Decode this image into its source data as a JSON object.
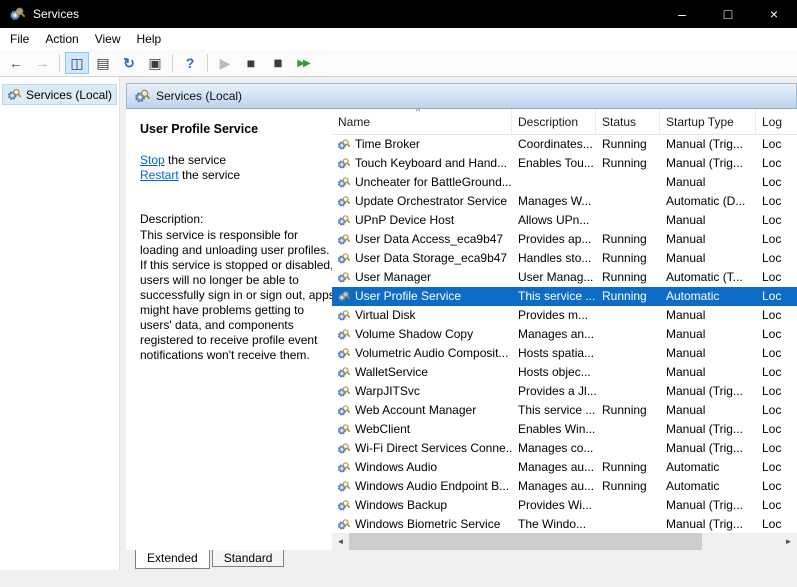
{
  "titlebar": {
    "title": "Services",
    "minimize_glyph": "–",
    "maximize_glyph": "□",
    "close_glyph": "×"
  },
  "menu": {
    "items": [
      "File",
      "Action",
      "View",
      "Help"
    ]
  },
  "toolbar": {
    "buttons": [
      {
        "name": "back-arrow-icon",
        "glyph": "←"
      },
      {
        "name": "forward-arrow-icon",
        "glyph": "→"
      },
      {
        "name": "show-hide-console-tree-icon",
        "glyph": "◫"
      },
      {
        "name": "export-list-icon",
        "glyph": "▤"
      },
      {
        "name": "refresh-icon",
        "glyph": "↻"
      },
      {
        "name": "properties-icon",
        "glyph": "▣"
      },
      {
        "name": "help-icon",
        "glyph": "?"
      },
      {
        "name": "start-service-icon",
        "glyph": "▶"
      },
      {
        "name": "stop-service-icon",
        "glyph": "■"
      },
      {
        "name": "pause-service-icon",
        "glyph": "▮▮"
      },
      {
        "name": "restart-service-icon",
        "glyph": "▶▶"
      }
    ]
  },
  "tree": {
    "root_label": "Services (Local)"
  },
  "content_header": {
    "label": "Services (Local)"
  },
  "extended_panel": {
    "service_title": "User Profile Service",
    "stop_link": "Stop",
    "stop_suffix": " the service",
    "restart_link": "Restart",
    "restart_suffix": " the service",
    "description_label": "Description:",
    "description_text": "This service is responsible for loading and unloading user profiles. If this service is stopped or disabled, users will no longer be able to successfully sign in or sign out, apps might have problems getting to users' data, and components registered to receive profile event notifications won't receive them."
  },
  "table": {
    "columns": [
      "Name",
      "Description",
      "Status",
      "Startup Type",
      "Log"
    ],
    "sort_indicator": "^",
    "selected_index": 8,
    "rows": [
      {
        "name": "Time Broker",
        "description": "Coordinates...",
        "status": "Running",
        "startup": "Manual (Trig...",
        "logon": "Loc"
      },
      {
        "name": "Touch Keyboard and Hand...",
        "description": "Enables Tou...",
        "status": "Running",
        "startup": "Manual (Trig...",
        "logon": "Loc"
      },
      {
        "name": "Uncheater for BattleGround...",
        "description": "",
        "status": "",
        "startup": "Manual",
        "logon": "Loc"
      },
      {
        "name": "Update Orchestrator Service",
        "description": "Manages W...",
        "status": "",
        "startup": "Automatic (D...",
        "logon": "Loc"
      },
      {
        "name": "UPnP Device Host",
        "description": "Allows UPn...",
        "status": "",
        "startup": "Manual",
        "logon": "Loc"
      },
      {
        "name": "User Data Access_eca9b47",
        "description": "Provides ap...",
        "status": "Running",
        "startup": "Manual",
        "logon": "Loc"
      },
      {
        "name": "User Data Storage_eca9b47",
        "description": "Handles sto...",
        "status": "Running",
        "startup": "Manual",
        "logon": "Loc"
      },
      {
        "name": "User Manager",
        "description": "User Manag...",
        "status": "Running",
        "startup": "Automatic (T...",
        "logon": "Loc"
      },
      {
        "name": "User Profile Service",
        "description": "This service ...",
        "status": "Running",
        "startup": "Automatic",
        "logon": "Loc"
      },
      {
        "name": "Virtual Disk",
        "description": "Provides m...",
        "status": "",
        "startup": "Manual",
        "logon": "Loc"
      },
      {
        "name": "Volume Shadow Copy",
        "description": "Manages an...",
        "status": "",
        "startup": "Manual",
        "logon": "Loc"
      },
      {
        "name": "Volumetric Audio Composit...",
        "description": "Hosts spatia...",
        "status": "",
        "startup": "Manual",
        "logon": "Loc"
      },
      {
        "name": "WalletService",
        "description": "Hosts objec...",
        "status": "",
        "startup": "Manual",
        "logon": "Loc"
      },
      {
        "name": "WarpJITSvc",
        "description": "Provides a Jl...",
        "status": "",
        "startup": "Manual (Trig...",
        "logon": "Loc"
      },
      {
        "name": "Web Account Manager",
        "description": "This service ...",
        "status": "Running",
        "startup": "Manual",
        "logon": "Loc"
      },
      {
        "name": "WebClient",
        "description": "Enables Win...",
        "status": "",
        "startup": "Manual (Trig...",
        "logon": "Loc"
      },
      {
        "name": "Wi-Fi Direct Services Conne...",
        "description": "Manages co...",
        "status": "",
        "startup": "Manual (Trig...",
        "logon": "Loc"
      },
      {
        "name": "Windows Audio",
        "description": "Manages au...",
        "status": "Running",
        "startup": "Automatic",
        "logon": "Loc"
      },
      {
        "name": "Windows Audio Endpoint B...",
        "description": "Manages au...",
        "status": "Running",
        "startup": "Automatic",
        "logon": "Loc"
      },
      {
        "name": "Windows Backup",
        "description": "Provides Wi...",
        "status": "",
        "startup": "Manual (Trig...",
        "logon": "Loc"
      },
      {
        "name": "Windows Biometric Service",
        "description": "The Windo...",
        "status": "",
        "startup": "Manual (Trig...",
        "logon": "Loc"
      }
    ]
  },
  "tabs": {
    "items": [
      "Extended",
      "Standard"
    ],
    "active": "Extended"
  },
  "colors": {
    "selection": "#0d6cc6",
    "titlebar": "#000000",
    "link": "#0066cc"
  }
}
